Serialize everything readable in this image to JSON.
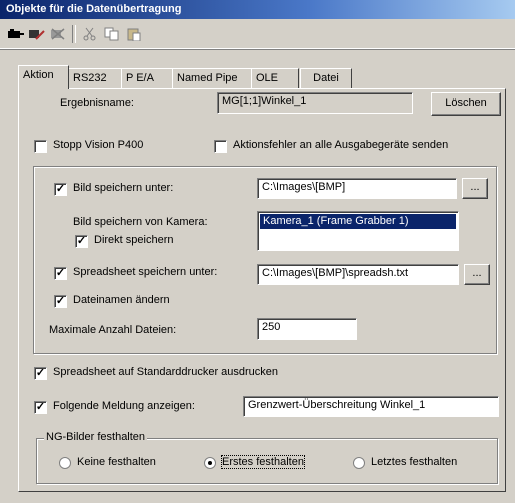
{
  "window": {
    "title": "Objekte für die Datenübertragung"
  },
  "toolbar": {
    "buttons": [
      {
        "icon": "add-object-icon"
      },
      {
        "icon": "edit-object-icon"
      },
      {
        "icon": "delete-object-icon"
      },
      {
        "icon": "cut-icon"
      },
      {
        "icon": "copy-icon"
      },
      {
        "icon": "paste-icon"
      }
    ]
  },
  "tabs": [
    {
      "label": "Aktion",
      "active": true
    },
    {
      "label": "RS232"
    },
    {
      "label": "P E/A"
    },
    {
      "label": "Named Pipe"
    },
    {
      "label": "OLE"
    },
    {
      "label": "Datei"
    }
  ],
  "form": {
    "result_name_label": "Ergebnisname:",
    "result_name_value": "MG[1;1]Winkel_1",
    "delete_button": "Löschen",
    "stop_vision_label": "Stopp Vision P400",
    "stop_vision_checked": false,
    "action_error_label": "Aktionsfehler an alle Ausgabegeräte senden",
    "action_error_checked": false,
    "save_image_label": "Bild speichern unter:",
    "save_image_checked": true,
    "save_image_path": "C:\\Images\\[BMP]",
    "browse_label": "...",
    "camera_label": "Bild speichern von Kamera:",
    "camera_selected": "Kamera_1 (Frame Grabber 1)",
    "direct_save_label": "Direkt speichern",
    "direct_save_checked": true,
    "spreadsheet_label": "Spreadsheet speichern unter:",
    "spreadsheet_checked": true,
    "spreadsheet_path": "C:\\Images\\[BMP]\\spreadsh.txt",
    "rename_files_label": "Dateinamen ändern",
    "rename_files_checked": true,
    "max_files_label": "Maximale Anzahl Dateien:",
    "max_files_value": "250",
    "print_spreadsheet_label": "Spreadsheet auf Standarddrucker ausdrucken",
    "print_spreadsheet_checked": true,
    "show_message_label": "Folgende Meldung anzeigen:",
    "show_message_checked": true,
    "message_value": "Grenzwert-Überschreitung Winkel_1",
    "ng_group_title": "NG-Bilder festhalten",
    "ng_options": [
      {
        "label": "Keine festhalten",
        "selected": false
      },
      {
        "label": "Erstes festhalten",
        "selected": true
      },
      {
        "label": "Letztes festhalten",
        "selected": false
      }
    ]
  },
  "colors": {
    "selection": "#0a246a",
    "face": "#d4d0c8",
    "title_start": "#0a246a",
    "title_end": "#a6caf0"
  }
}
